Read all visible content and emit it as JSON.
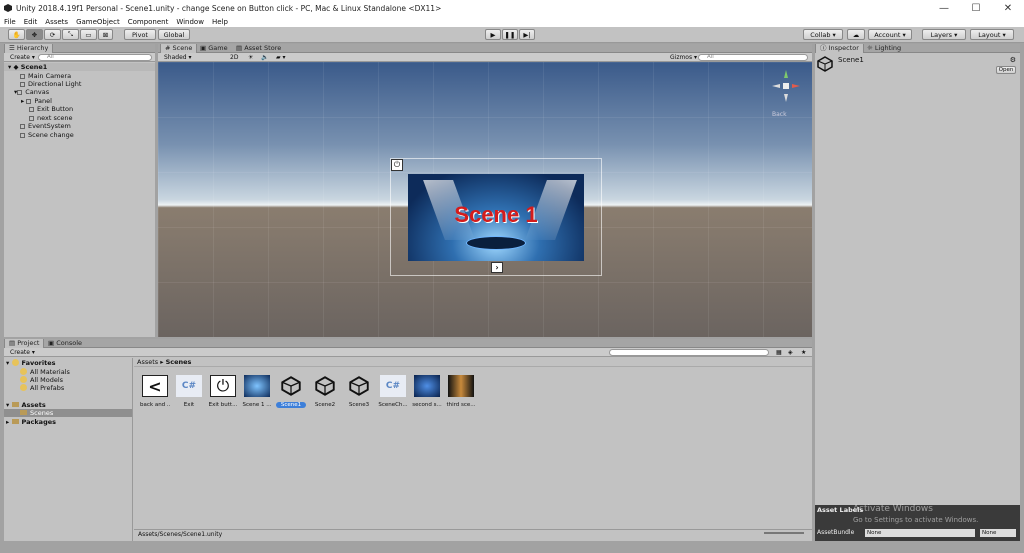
{
  "window": {
    "title": "Unity 2018.4.19f1 Personal - Scene1.unity - change Scene on Button click - PC, Mac & Linux Standalone <DX11>"
  },
  "menu": [
    "File",
    "Edit",
    "Assets",
    "GameObject",
    "Component",
    "Window",
    "Help"
  ],
  "toolbar": {
    "pivot": "Pivot",
    "global": "Global",
    "collab": "Collab",
    "account": "Account",
    "layers": "Layers",
    "layout": "Layout"
  },
  "hierarchy": {
    "tab": "Hierarchy",
    "create": "Create",
    "search": "All",
    "scene": "Scene1",
    "items": [
      "Main Camera",
      "Directional Light",
      "Canvas",
      "Panel",
      "Exit Button",
      "next scene",
      "EventSystem",
      "Scene change"
    ]
  },
  "sceneview": {
    "tabs": [
      "Scene",
      "Game",
      "Asset Store"
    ],
    "shading": "Shaded",
    "mode2d": "2D",
    "gizmos": "Gizmos",
    "search": "All",
    "back_label": "Back",
    "banner_text": "Scene 1"
  },
  "inspector": {
    "tabs": [
      "Inspector",
      "Lighting"
    ],
    "object": "Scene1",
    "open": "Open"
  },
  "project": {
    "tabs": [
      "Project",
      "Console"
    ],
    "create": "Create",
    "favorites": "Favorites",
    "fav_items": [
      "All Materials",
      "All Models",
      "All Prefabs"
    ],
    "assets": "Assets",
    "scenes": "Scenes",
    "packages": "Packages",
    "breadcrumb": [
      "Assets",
      "Scenes"
    ],
    "files": [
      {
        "name": "back and ...",
        "kind": "back"
      },
      {
        "name": "Exit",
        "kind": "cs"
      },
      {
        "name": "Exit butt...",
        "kind": "power"
      },
      {
        "name": "Scene 1 ...",
        "kind": "img"
      },
      {
        "name": "Scene1",
        "kind": "unity",
        "selected": true
      },
      {
        "name": "Scene2",
        "kind": "unity"
      },
      {
        "name": "Scene3",
        "kind": "unity"
      },
      {
        "name": "SceneCh...",
        "kind": "cs"
      },
      {
        "name": "second s...",
        "kind": "img2"
      },
      {
        "name": "third sce...",
        "kind": "img3"
      }
    ],
    "path": "Assets/Scenes/Scene1.unity"
  },
  "asset_labels": {
    "title": "Asset Labels",
    "assetbundle": "AssetBundle",
    "none1": "None",
    "none2": "None"
  },
  "watermark": {
    "line1": "Activate Windows",
    "line2": "Go to Settings to activate Windows."
  }
}
